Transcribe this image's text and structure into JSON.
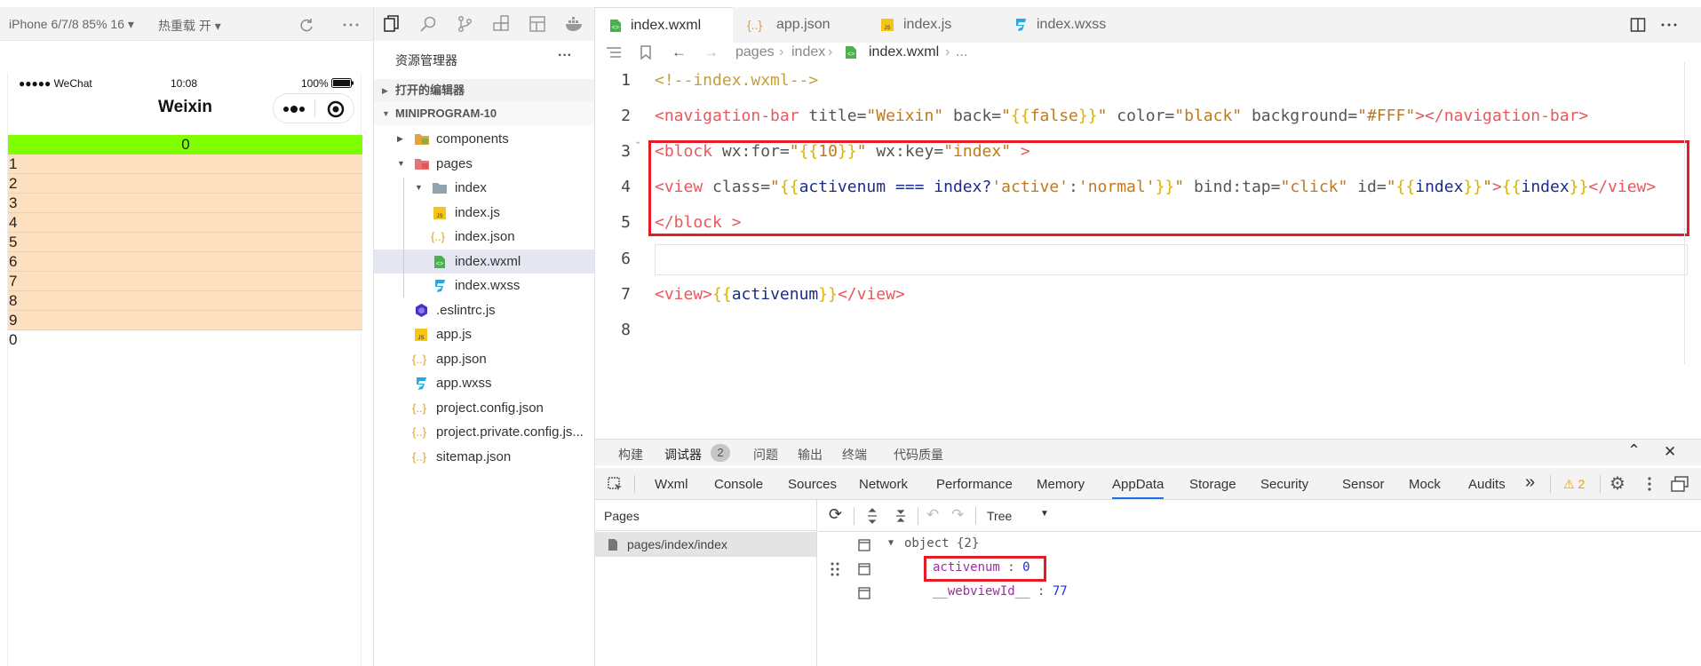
{
  "simulator": {
    "device": "iPhone 6/7/8 85% 16 ▾",
    "hot_reload": "热重载 开 ▾",
    "status_left": "●●●●● WeChat",
    "status_time": "10:08",
    "status_battery": "100%",
    "nav_title": "Weixin",
    "active_row": "0",
    "rows": [
      "1",
      "2",
      "3",
      "4",
      "5",
      "6",
      "7",
      "8",
      "9"
    ],
    "footer_value": "0"
  },
  "explorer": {
    "title": "资源管理器",
    "more": "···",
    "open_editors": "打开的编辑器",
    "project": "MINIPROGRAM-10",
    "items": [
      {
        "label": "components",
        "icon": "folder-icon"
      },
      {
        "label": "pages",
        "icon": "folder-icon"
      },
      {
        "label": "index",
        "icon": "folder-icon"
      },
      {
        "label": "index.js",
        "icon": "js-file-icon"
      },
      {
        "label": "index.json",
        "icon": "json-file-icon"
      },
      {
        "label": "index.wxml",
        "icon": "wxml-file-icon"
      },
      {
        "label": "index.wxss",
        "icon": "css-file-icon"
      },
      {
        "label": ".eslintrc.js",
        "icon": "eslint-file-icon"
      },
      {
        "label": "app.js",
        "icon": "js-file-icon"
      },
      {
        "label": "app.json",
        "icon": "json-file-icon"
      },
      {
        "label": "app.wxss",
        "icon": "css-file-icon"
      },
      {
        "label": "project.config.json",
        "icon": "json-file-icon"
      },
      {
        "label": "project.private.config.js...",
        "icon": "json-file-icon"
      },
      {
        "label": "sitemap.json",
        "icon": "json-file-icon"
      }
    ]
  },
  "editor": {
    "tabs": [
      {
        "label": "index.wxml",
        "icon": "wxml-file-icon"
      },
      {
        "label": "app.json",
        "icon": "json-file-icon"
      },
      {
        "label": "index.js",
        "icon": "js-file-icon"
      },
      {
        "label": "index.wxss",
        "icon": "css-file-icon"
      }
    ],
    "breadcrumb": [
      "pages",
      "index",
      "index.wxml",
      "..."
    ],
    "line_numbers": [
      "1",
      "2",
      "3",
      "4",
      "5",
      "6",
      "7",
      "8"
    ],
    "code": {
      "l1": "<!--index.wxml-->",
      "l2_a": "<navigation-bar",
      "l2_b": " title=",
      "l2_c": "\"Weixin\"",
      "l2_d": " back=",
      "l2_e": "\"",
      "l2_f": "{{",
      "l2_g": "false",
      "l2_h": "}}",
      "l2_i": "\"",
      "l2_j": " color=",
      "l2_k": "\"black\"",
      "l2_l": " background=",
      "l2_m": "\"#FFF\"",
      "l2_n": "></navigation-bar>",
      "l3_a": "<block",
      "l3_b": " wx:for=",
      "l3_c": "\"",
      "l3_d": "{{",
      "l3_e": "10",
      "l3_f": "}}",
      "l3_g": "\"",
      "l3_h": " wx:key=",
      "l3_i": "\"index\"",
      "l3_j": " >",
      "l4_a": "<view",
      "l4_b": " class=",
      "l4_c": "\"",
      "l4_d": "{{",
      "l4_e": "activenum === index?",
      "l4_f": "'active'",
      "l4_g": ":",
      "l4_h": "'normal'",
      "l4_i": "}}",
      "l4_j": "\"",
      "l4_k": " bind:tap=",
      "l4_l": "\"click\"",
      "l4_m": " id=",
      "l4_n": "\"",
      "l4_o": "{{",
      "l4_p": "index",
      "l4_q": "}}",
      "l4_r": "\"",
      "l4_s": ">",
      "l4_t": "{{",
      "l4_u": "index",
      "l4_v": "}}",
      "l4_w": "</view>",
      "l5_a": "</block",
      "l5_b": " >",
      "l7_a": "<view>",
      "l7_b": "{{",
      "l7_c": "activenum",
      "l7_d": "}}",
      "l7_e": "</view>"
    }
  },
  "panel": {
    "tabs": [
      "构建",
      "调试器",
      "问题",
      "输出",
      "终端",
      "代码质量"
    ],
    "debugger_badge": "2",
    "devtools_tabs": [
      "Wxml",
      "Console",
      "Sources",
      "Network",
      "Performance",
      "Memory",
      "AppData",
      "Storage",
      "Security",
      "Sensor",
      "Mock",
      "Audits"
    ],
    "more": "»",
    "warnings": "⚠ 2",
    "pages_header": "Pages",
    "page_path": "pages/index/index",
    "view_mode": "Tree",
    "tree": {
      "root": "object {2}",
      "key1": "activenum",
      "val1": "0",
      "key2": "__webviewId__",
      "val2": "77",
      "sep": " : "
    }
  }
}
